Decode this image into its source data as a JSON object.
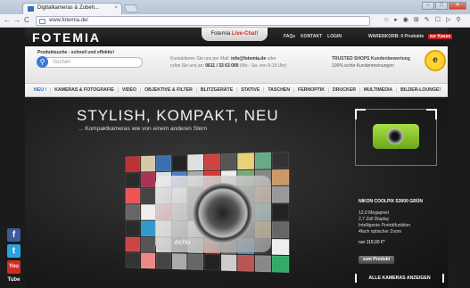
{
  "browser": {
    "tab_title": "Digitalkameras & Zubeh...",
    "tab_close": "×",
    "url": "www.fotemia.de/",
    "nav_back": "←",
    "nav_forward": "→",
    "nav_reload": "C",
    "window_minimize": "–",
    "window_maximize": "□",
    "window_close": "✕",
    "toolbar_icons": [
      "☆",
      "▸",
      "◉",
      "⊞",
      "✎",
      "☐",
      "▷",
      "⚲"
    ]
  },
  "header": {
    "logo": "FOTEMIA",
    "chat_prefix": "Fotemia",
    "chat_label": "Live-Chat!",
    "links": [
      "FAQs",
      "KONTAKT",
      "LOGIN"
    ],
    "cart_text": "WARENKORB: 0 Produkte",
    "cart_button": "zur Kasse"
  },
  "search": {
    "label": "Produktsuche - schnell und effektiv!",
    "placeholder": "Suchen"
  },
  "contact": {
    "line1_prefix": "Kontaktieren Sie uns per Mail:",
    "email": "info@fotemia.de",
    "line1_suffix": "oder",
    "line2_prefix": "rufen Sie uns an:",
    "phone": "0611 / 33 63 000",
    "line2_suffix": "(Mo.- Sa. von 9-19 Uhr)"
  },
  "trust": {
    "title": "TRUSTED SHOPS Kundenbewertung",
    "subtitle": "100% echte Kundenmeinungen",
    "seal_letter": "e"
  },
  "categories": [
    "NEU !",
    "KAMERAS & FOTOGRAFIE",
    "VIDEO",
    "OBJEKTIVE & FILTER",
    "BLITZGERÄTE",
    "STATIVE",
    "TASCHEN",
    "FERNOPTIK",
    "DRUCKER",
    "MULTIMEDIA",
    "BILDER-LOUNGE!"
  ],
  "hero": {
    "headline": "STYLISH, KOMPAKT, NEU",
    "subline": "... Kompaktkameras wie von einem anderen Stern",
    "camera_text": "echo",
    "product_name": "NIKON COOLPIX S3000 GRÜN",
    "specs": [
      "12,0 Megapixel",
      "2,7 Zoll Display",
      "Intelligente Porträtfunktion",
      "4fach optischer Zoom"
    ],
    "price": "nur 119,00 €*",
    "buy_label": "zum Produkt",
    "all_label": "ALLE KAMERAS ANZEIGEN"
  },
  "social": {
    "facebook": "f",
    "twitter": "t",
    "youtube": "You Tube"
  },
  "colors": {
    "accent_blue": "#2a6ac4",
    "cart_red": "#c81e1e",
    "product_green": "#8cc63f"
  }
}
